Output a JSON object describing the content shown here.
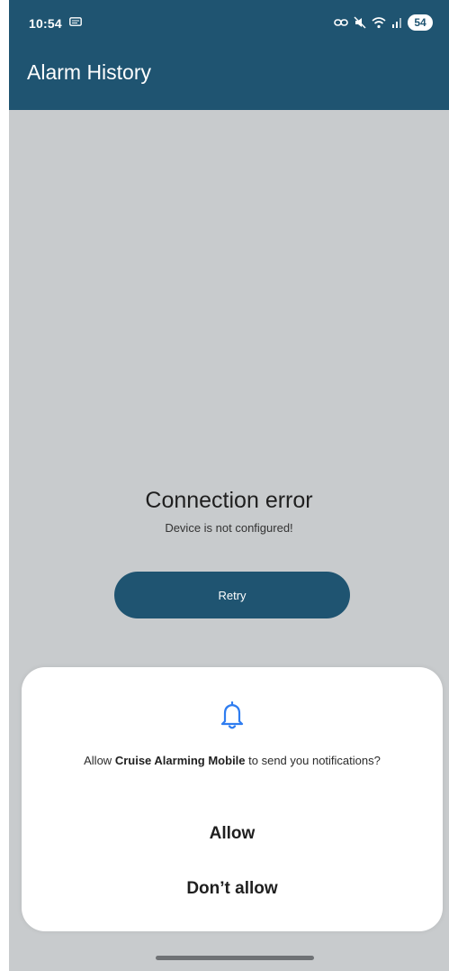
{
  "status_bar": {
    "time": "10:54",
    "battery": "54",
    "icons": [
      "message-icon",
      "link-icon",
      "mute-icon",
      "wifi-icon",
      "signal-icon",
      "battery-icon"
    ]
  },
  "app_bar": {
    "title": "Alarm History"
  },
  "main": {
    "error_title": "Connection error",
    "error_message": "Device is not configured!",
    "retry_label": "Retry"
  },
  "permission_dialog": {
    "icon": "bell-icon",
    "text_prefix": "Allow ",
    "app_name": "Cruise Alarming Mobile",
    "text_suffix": " to send you notifications?",
    "allow_label": "Allow",
    "deny_label": "Don’t allow"
  },
  "colors": {
    "primary": "#1f5471",
    "background": "#c8cbcd",
    "dialog": "#ffffff",
    "bell": "#2f7df0"
  }
}
